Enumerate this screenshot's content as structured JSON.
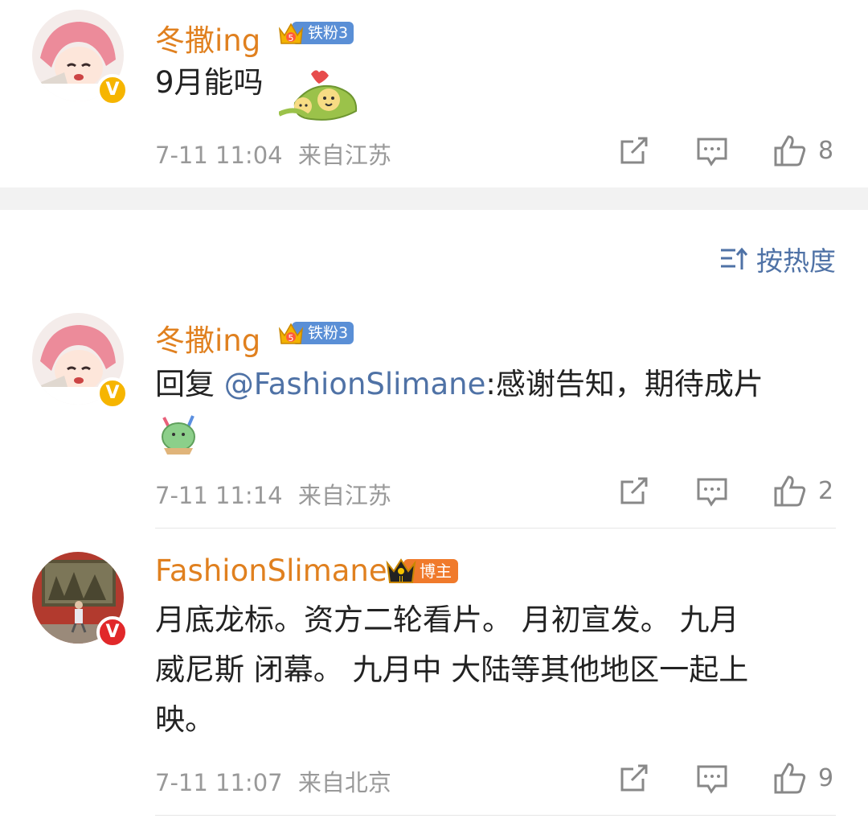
{
  "colors": {
    "username": "#e0801f",
    "mention": "#4f72a6",
    "fan_badge": "#5a8fd6",
    "boss_badge": "#f07a2b",
    "verified_gold": "#f6b500",
    "verified_red": "#e1282a"
  },
  "top_comment": {
    "username": "冬撒ing",
    "fan_badge": "铁粉3",
    "fan_level": "5",
    "text": "9月能吗",
    "time": "7-11 11:04",
    "location": "来自江苏",
    "likes": "8"
  },
  "sort": {
    "label": "按热度",
    "icon": "sort-icon"
  },
  "replies": [
    {
      "username": "冬撒ing",
      "fan_badge": "铁粉3",
      "fan_level": "5",
      "reply_prefix": "回复 ",
      "mention": "@FashionSlimane",
      "text": ":感谢告知，期待成片",
      "time": "7-11 11:14",
      "location": "来自江苏",
      "likes": "2"
    },
    {
      "username": "FashionSlimane",
      "role_badge": "博主",
      "crown_level": "II",
      "text_line1": "月底龙标。资方二轮看片。 月初宣发。 九月",
      "text_line2": "威尼斯 闭幕。 九月中 大陆等其他地区一起上",
      "text_line3": "映。",
      "time": "7-11 11:07",
      "location": "来自北京",
      "likes": "9"
    }
  ],
  "verified_mark": "V"
}
